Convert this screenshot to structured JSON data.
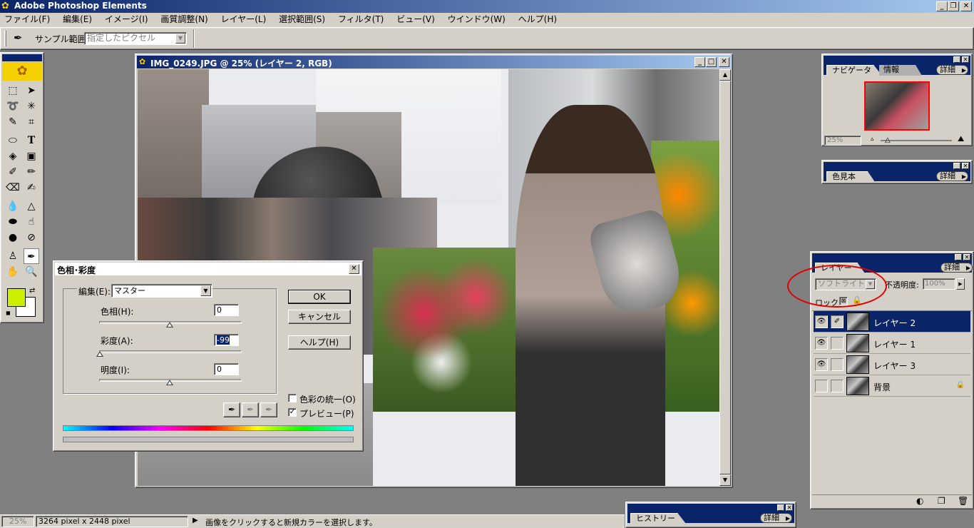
{
  "app": {
    "title": "Adobe Photoshop Elements"
  },
  "menu": [
    "ファイル(F)",
    "編集(E)",
    "イメージ(I)",
    "画質調整(N)",
    "レイヤー(L)",
    "選択範囲(S)",
    "フィルタ(T)",
    "ビュー(V)",
    "ウインドウ(W)",
    "ヘルプ(H)"
  ],
  "options_bar": {
    "sample_label": "サンプル範囲:",
    "sample_value": "指定したピクセル"
  },
  "document": {
    "title": "IMG_0249.JPG @ 25% (レイヤー 2, RGB)"
  },
  "colors": {
    "foreground": "#ccee00",
    "background": "#ffffff",
    "title_active": "#0a246a",
    "title_inactive": "#808080",
    "annotation_circle": "#e00000"
  },
  "dialog": {
    "title": "色相･彩度",
    "edit_label": "編集(E):",
    "edit_value": "マスター",
    "hue_label": "色相(H):",
    "hue_value": "0",
    "saturation_label": "彩度(A):",
    "saturation_value": "-99",
    "lightness_label": "明度(I):",
    "lightness_value": "0",
    "ok": "OK",
    "cancel": "キャンセル",
    "help": "ヘルプ(H)",
    "colorize_label": "色彩の統一(O)",
    "colorize_checked": false,
    "preview_label": "プレビュー(P)",
    "preview_checked": true
  },
  "navigator": {
    "tab1": "ナビゲータ",
    "tab2": "情報",
    "more": "詳細",
    "zoom": "25%"
  },
  "swatches": {
    "tab": "色見本",
    "more": "詳細"
  },
  "layers": {
    "tab": "レイヤー",
    "more": "詳細",
    "blend_mode": "ソフトライト",
    "opacity_label": "不透明度:",
    "opacity_value": "100%",
    "lock_label": "ロック:",
    "items": [
      {
        "name": "レイヤー 2",
        "visible": true,
        "selected": true
      },
      {
        "name": "レイヤー 1",
        "visible": true,
        "selected": false
      },
      {
        "name": "レイヤー 3",
        "visible": true,
        "selected": false
      },
      {
        "name": "背景",
        "visible": false,
        "selected": false,
        "locked": true
      }
    ]
  },
  "history": {
    "tab": "ヒストリー",
    "more": "詳細"
  },
  "status": {
    "zoom": "25%",
    "doc_size": "3264 pixel x 2448 pixel",
    "message": "画像をクリックすると新規カラーを選択します。"
  }
}
